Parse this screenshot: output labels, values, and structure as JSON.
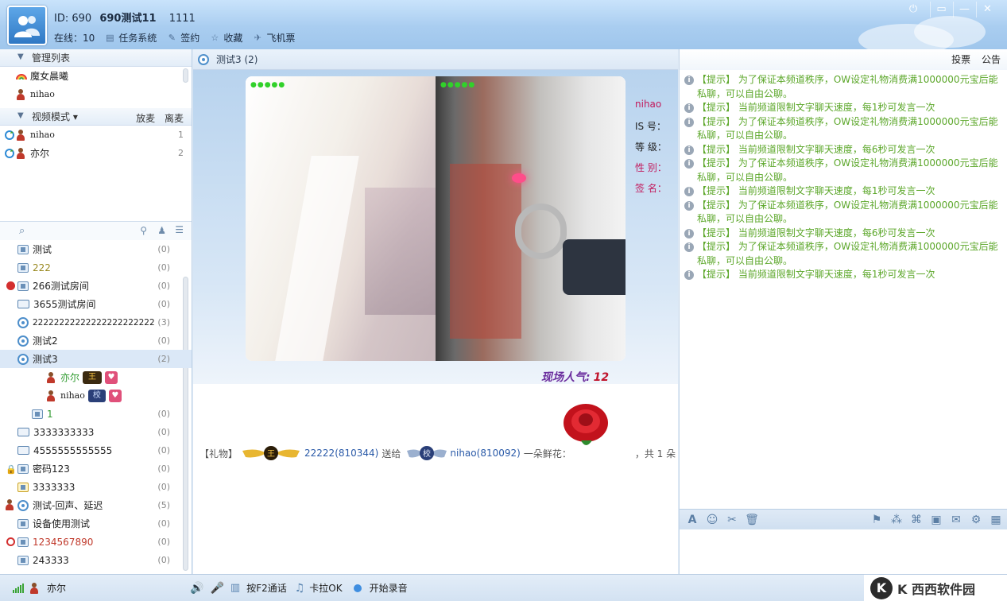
{
  "header": {
    "id_label": "ID: 690",
    "username": "690测试11",
    "signature": "1111",
    "online": "在线：10",
    "toolbar": [
      {
        "label": "任务系统",
        "icon": "task-icon"
      },
      {
        "label": "签约",
        "icon": "pen-icon"
      },
      {
        "label": "收藏",
        "icon": "star-icon"
      },
      {
        "label": "飞机票",
        "icon": "plane-icon"
      }
    ]
  },
  "left": {
    "manage_title": "管理列表",
    "managers": [
      {
        "name": "魔女晨曦",
        "icon": "rainbow-icon"
      },
      {
        "name": "nihao",
        "icon": "user-icon"
      }
    ],
    "video_mode": "视频模式",
    "fangmai": "放麦",
    "limai": "离麦",
    "mic_users": [
      {
        "name": "nihao",
        "num": "1"
      },
      {
        "name": "亦尔",
        "num": "2"
      }
    ],
    "rooms": [
      {
        "name": "测试",
        "count": "(0)",
        "color": "#222"
      },
      {
        "name": "222",
        "count": "(0)",
        "color": "#9a8a22"
      },
      {
        "name": "266测试房间",
        "count": "(0)",
        "color": "#222"
      },
      {
        "name": "3655测试房间",
        "count": "(0)",
        "color": "#222"
      },
      {
        "name": "22222222222222222222222",
        "count": "(3)",
        "color": "#222"
      },
      {
        "name": "测试2",
        "count": "(0)",
        "color": "#222"
      },
      {
        "name": "测试3",
        "count": "(2)",
        "color": "#222"
      },
      {
        "name": "1",
        "count": "(0)",
        "color": "#2e9a2e"
      },
      {
        "name": "3333333333",
        "count": "(0)",
        "color": "#222"
      },
      {
        "name": "4555555555555",
        "count": "(0)",
        "color": "#222"
      },
      {
        "name": "密码123",
        "count": "(0)",
        "color": "#222"
      },
      {
        "name": "3333333",
        "count": "(0)",
        "color": "#222"
      },
      {
        "name": "测试-回声、延迟",
        "count": "(5)",
        "color": "#222"
      },
      {
        "name": "设备使用测试",
        "count": "(0)",
        "color": "#222"
      },
      {
        "name": "1234567890",
        "count": "(0)",
        "color": "#c0392b"
      },
      {
        "name": "243333",
        "count": "(0)",
        "color": "#222"
      }
    ],
    "room_users": [
      {
        "name": "亦尔",
        "badge1": "王",
        "badge2": "♥"
      },
      {
        "name": "nihao",
        "badge1": "校",
        "badge2": "♥"
      }
    ]
  },
  "center": {
    "tab_title": "测试3 (2)",
    "profile": {
      "name": "nihao",
      "fields": [
        "IS  号：",
        "等  级：",
        "性  别：",
        "签  名："
      ]
    },
    "popularity_label": "现场人气:",
    "popularity_value": "12",
    "gift": {
      "prefix": "【礼物】",
      "sender": "22222(810344)",
      "verb": "送给",
      "receiver": "nihao(810092)",
      "item": "一朵鲜花：",
      "total": "，共 1 朵"
    }
  },
  "right": {
    "vote": "投票",
    "notice": "公告",
    "messages": [
      "【提示】 为了保证本频道秩序，OW设定礼物消费满1000000元宝后能私聊，可以自由公聊。",
      "【提示】 当前频道限制文字聊天速度，每1秒可发言一次",
      "【提示】 为了保证本频道秩序，OW设定礼物消费满1000000元宝后能私聊，可以自由公聊。",
      "【提示】 当前频道限制文字聊天速度，每6秒可发言一次",
      "【提示】 为了保证本频道秩序，OW设定礼物消费满1000000元宝后能私聊，可以自由公聊。",
      "【提示】 当前频道限制文字聊天速度，每1秒可发言一次",
      "【提示】 为了保证本频道秩序，OW设定礼物消费满1000000元宝后能私聊，可以自由公聊。",
      "【提示】 当前频道限制文字聊天速度，每6秒可发言一次",
      "【提示】 为了保证本频道秩序，OW设定礼物消费满1000000元宝后能私聊，可以自由公聊。",
      "【提示】 当前频道限制文字聊天速度，每1秒可发言一次"
    ]
  },
  "bottom": {
    "self_name": "亦尔",
    "talk": "按F2通话",
    "karaoke": "卡拉OK",
    "record": "开始录音",
    "watermark": "K 西西软件园"
  },
  "colors": {
    "accent": "#2f78c4",
    "chat_green": "#5ca72a",
    "popularity_purple": "#6b2e9e"
  }
}
